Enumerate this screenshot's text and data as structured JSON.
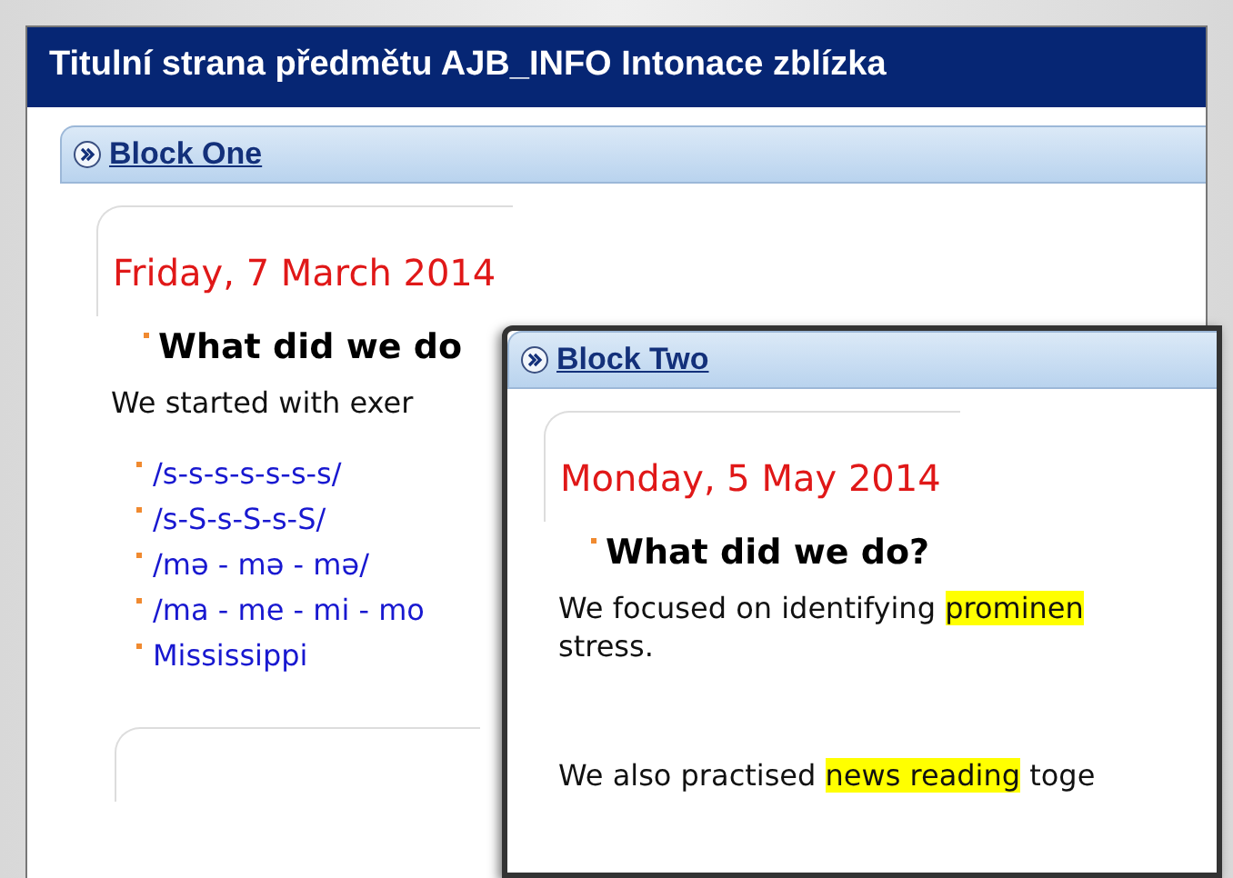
{
  "window": {
    "title": "Titulní strana předmětu AJB_INFO Intonace zblízka"
  },
  "blocks": [
    {
      "title": "Block One",
      "date": "Friday, 7 March 2014",
      "heading": "What did we do",
      "paragraphs": [
        [
          {
            "text": "We started with exer",
            "highlighted": false
          }
        ]
      ],
      "list": [
        "/s-s-s-s-s-s-s/",
        "/s-S-s-S-s-S/",
        "/mə - mə - mə/",
        "/ma - me - mi - mo",
        "Mississippi"
      ]
    },
    {
      "title": "Block Two",
      "date": "Monday, 5 May 2014",
      "heading": "What did we do?",
      "paragraphs": [
        [
          {
            "text": " We focused on identifying ",
            "highlighted": false
          },
          {
            "text": "prominen",
            "highlighted": true
          }
        ],
        [
          {
            "text": "stress.",
            "highlighted": false
          }
        ],
        [
          {
            "text": "We also practised ",
            "highlighted": false
          },
          {
            "text": "news reading",
            "highlighted": true
          },
          {
            "text": " toge",
            "highlighted": false
          }
        ]
      ]
    }
  ]
}
